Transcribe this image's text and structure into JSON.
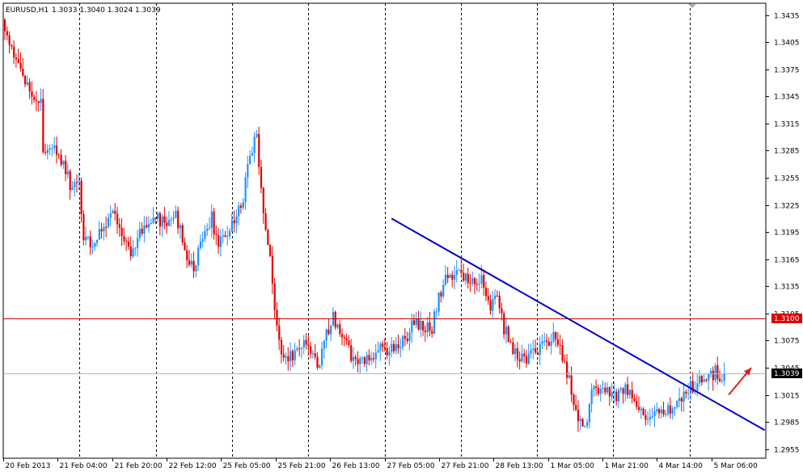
{
  "header": {
    "symbol": "EURUSD,H1",
    "ohlc": "1.3033 1.3040 1.3024 1.3039"
  },
  "colors": {
    "bull": "#1e90ff",
    "bear": "#e00000",
    "grid": "#000000",
    "trendline": "#0000cc",
    "level": "#cc0000",
    "price_line": "#b4b4b4",
    "arrow": "#dd2222",
    "badge_level": "#e00000",
    "badge_price": "#000000"
  },
  "chart_data": {
    "type": "candlestick",
    "symbol": "EURUSD",
    "timeframe": "H1",
    "ylim": [
      1.2945,
      1.3448
    ],
    "y_ticks": [
      "1.3435",
      "1.3405",
      "1.3375",
      "1.3345",
      "1.3315",
      "1.3285",
      "1.3255",
      "1.3225",
      "1.3195",
      "1.3165",
      "1.3135",
      "1.3105",
      "1.3075",
      "1.3045",
      "1.3015",
      "1.2985",
      "1.2955"
    ],
    "x_ticks": [
      "20 Feb 2013",
      "21 Feb 04:00",
      "21 Feb 20:00",
      "22 Feb 12:00",
      "25 Feb 05:00",
      "25 Feb 21:00",
      "26 Feb 13:00",
      "27 Feb 05:00",
      "27 Feb 21:00",
      "28 Feb 13:00",
      "1 Mar 05:00",
      "1 Mar 21:00",
      "4 Mar 14:00",
      "5 Mar 06:00"
    ],
    "vertical_grid_count": 10,
    "close_path": [
      [
        0,
        1.3425
      ],
      [
        4,
        1.339
      ],
      [
        8,
        1.337
      ],
      [
        13,
        1.3345
      ],
      [
        16,
        1.3335
      ],
      [
        17,
        1.328
      ],
      [
        22,
        1.3285
      ],
      [
        26,
        1.327
      ],
      [
        30,
        1.324
      ],
      [
        33,
        1.325
      ],
      [
        35,
        1.319
      ],
      [
        40,
        1.318
      ],
      [
        44,
        1.3205
      ],
      [
        48,
        1.3215
      ],
      [
        52,
        1.3185
      ],
      [
        56,
        1.3175
      ],
      [
        60,
        1.3195
      ],
      [
        64,
        1.32
      ],
      [
        68,
        1.321
      ],
      [
        72,
        1.3205
      ],
      [
        76,
        1.3215
      ],
      [
        80,
        1.3175
      ],
      [
        84,
        1.3155
      ],
      [
        86,
        1.3175
      ],
      [
        89,
        1.3195
      ],
      [
        92,
        1.321
      ],
      [
        94,
        1.3185
      ],
      [
        98,
        1.319
      ],
      [
        102,
        1.321
      ],
      [
        106,
        1.3235
      ],
      [
        110,
        1.329
      ],
      [
        112,
        1.33
      ],
      [
        114,
        1.324
      ],
      [
        116,
        1.319
      ],
      [
        118,
        1.3175
      ],
      [
        120,
        1.311
      ],
      [
        122,
        1.3075
      ],
      [
        124,
        1.3055
      ],
      [
        128,
        1.306
      ],
      [
        132,
        1.3075
      ],
      [
        136,
        1.306
      ],
      [
        140,
        1.305
      ],
      [
        144,
        1.309
      ],
      [
        146,
        1.31
      ],
      [
        150,
        1.3085
      ],
      [
        154,
        1.306
      ],
      [
        158,
        1.305
      ],
      [
        162,
        1.3055
      ],
      [
        166,
        1.3065
      ],
      [
        170,
        1.306
      ],
      [
        174,
        1.307
      ],
      [
        178,
        1.3075
      ],
      [
        182,
        1.3095
      ],
      [
        186,
        1.309
      ],
      [
        190,
        1.309
      ],
      [
        193,
        1.3125
      ],
      [
        196,
        1.3145
      ],
      [
        200,
        1.315
      ],
      [
        204,
        1.3145
      ],
      [
        208,
        1.314
      ],
      [
        212,
        1.314
      ],
      [
        214,
        1.312
      ],
      [
        216,
        1.3105
      ],
      [
        218,
        1.313
      ],
      [
        220,
        1.311
      ],
      [
        222,
        1.309
      ],
      [
        224,
        1.308
      ],
      [
        226,
        1.3065
      ],
      [
        228,
        1.306
      ],
      [
        232,
        1.3055
      ],
      [
        236,
        1.3065
      ],
      [
        240,
        1.307
      ],
      [
        244,
        1.308
      ],
      [
        246,
        1.3075
      ],
      [
        248,
        1.306
      ],
      [
        250,
        1.304
      ],
      [
        252,
        1.302
      ],
      [
        254,
        1.3
      ],
      [
        256,
        1.2985
      ],
      [
        258,
        1.2975
      ],
      [
        260,
        1.301
      ],
      [
        262,
        1.3025
      ],
      [
        264,
        1.3015
      ],
      [
        268,
        1.302
      ],
      [
        272,
        1.3015
      ],
      [
        276,
        1.3025
      ],
      [
        280,
        1.301
      ],
      [
        284,
        1.2995
      ],
      [
        288,
        1.299
      ],
      [
        292,
        1.2995
      ],
      [
        296,
        1.3
      ],
      [
        300,
        1.301
      ],
      [
        304,
        1.302
      ],
      [
        308,
        1.303
      ],
      [
        312,
        1.303
      ],
      [
        316,
        1.304
      ],
      [
        318,
        1.3035
      ],
      [
        320,
        1.3039
      ]
    ],
    "overlays": {
      "horizontal_level": 1.31,
      "horizontal_level_label": "1.3100",
      "current_price": 1.3039,
      "current_price_label": "1.3039",
      "trendline": {
        "from": [
          172,
          1.321
        ],
        "to": [
          338,
          1.2976
        ]
      },
      "arrow": {
        "from": [
          322,
          1.3015
        ],
        "to": [
          332,
          1.3045
        ]
      }
    }
  }
}
